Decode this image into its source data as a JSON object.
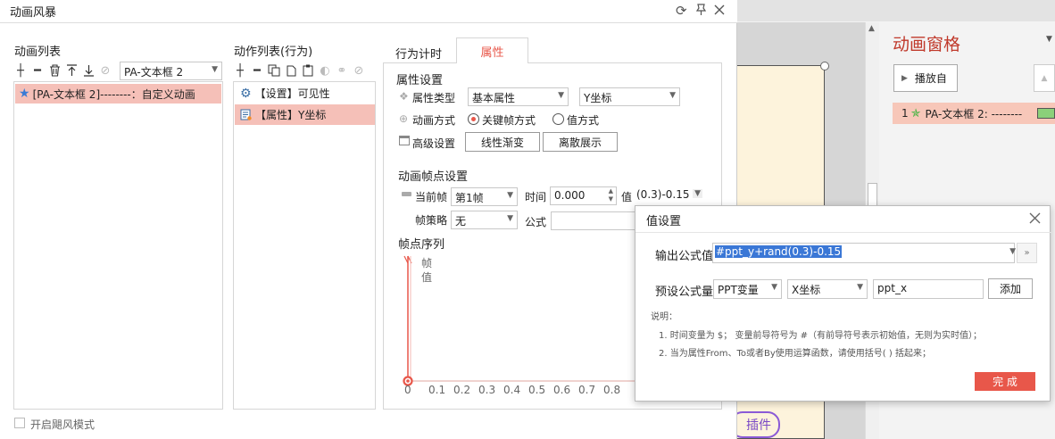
{
  "main": {
    "title": "动画风暴",
    "anim_list_title": "动画列表",
    "anim_list_combo": "PA-文本框 2",
    "anim_list_items": [
      "[PA-文本框 2]--------：自定义动画"
    ],
    "action_list_title": "动作列表(行为)",
    "action_items": [
      "【设置】可见性",
      "【属性】Y坐标"
    ],
    "tabs": [
      "行为计时",
      "属性"
    ],
    "prop_title": "属性设置",
    "prop_type_label": "属性类型",
    "prop_type_value": "基本属性",
    "prop_coord_value": "Y坐标",
    "anim_mode_label": "动画方式",
    "mode_keyframe": "关键帧方式",
    "mode_value": "值方式",
    "advanced_label": "高级设置",
    "btn_linear": "线性渐变",
    "btn_discrete": "离散展示",
    "keyframe_title": "动画帧点设置",
    "current_frame_label": "当前帧",
    "current_frame_value": "第1帧",
    "time_label": "时间",
    "time_value": "0.000",
    "value_label": "值",
    "value_value": "(0.3)-0.15",
    "strategy_label": "帧策略",
    "strategy_value": "无",
    "formula_label": "公式",
    "seq_title": "帧点序列",
    "axis_y_label_1": "帧",
    "axis_y_label_2": "值",
    "axis_ticks": [
      "0",
      "0.1",
      "0.2",
      "0.3",
      "0.4",
      "0.5",
      "0.6",
      "0.7",
      "0.8"
    ],
    "storm_mode": "开启飓风模式"
  },
  "value_dialog": {
    "title": "值设置",
    "output_label": "输出公式值",
    "output_value": "#ppt_y+rand(0.3)-0.15",
    "preset_label": "预设公式量",
    "preset_var": "PPT变量",
    "preset_coord": "X坐标",
    "preset_input": "ppt_x",
    "add_button": "添加",
    "desc_title": "说明：",
    "desc_1": "1. 时间变量为 $；  变量前导符号为 #（有前导符号表示初始值，无则为实时值）；",
    "desc_2": "2. 当为属性From、To或者By使用运算函数，请使用括号( ) 括起来；",
    "done_button": "完 成"
  },
  "background": {
    "anim_pane_title": "动画窗格",
    "play_button": "播放自",
    "pane_item_num": "1",
    "pane_item_label": "PA-文本框 2: --------",
    "plugin_label": "插件"
  },
  "colors": {
    "accent_red": "#e8574a",
    "selection": "#f5c0b8",
    "star_green": "#3cb33c",
    "star_blue": "#3a7bd5"
  }
}
